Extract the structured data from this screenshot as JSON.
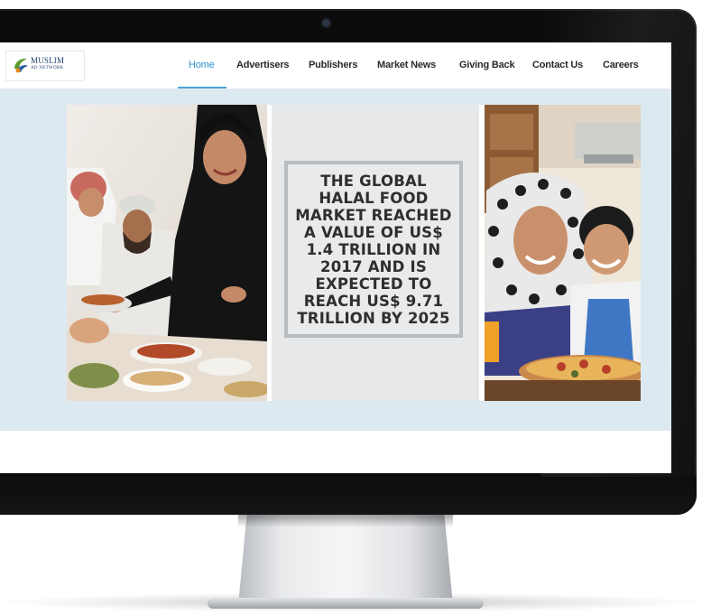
{
  "site": {
    "logo": {
      "name": "MUSLIM",
      "sub": "AD NETWORK"
    },
    "nav": {
      "items": [
        {
          "label": "Home",
          "active": true
        },
        {
          "label": "Advertisers",
          "active": false
        },
        {
          "label": "Publishers",
          "active": false
        },
        {
          "label": "Market News",
          "active": false
        },
        {
          "label": "Giving Back",
          "active": false
        },
        {
          "label": "Contact Us",
          "active": false
        },
        {
          "label": "Careers",
          "active": false
        }
      ]
    },
    "slider": {
      "headline": "THE GLOBAL HALAL FOOD MARKET REACHED A VALUE OF US$ 1.4 TRILLION IN 2017 AND IS EXPECTED TO REACH US$ 9.71 TRILLION BY 2025",
      "slide_count": 3,
      "active_slide": 2,
      "left_image": "family-dining-photo",
      "right_image": "mother-and-child-pizza-photo"
    }
  },
  "colors": {
    "accent": "#2b8fcf",
    "hero_bg": "#dde9f1",
    "bezel": "#0b0b0c"
  }
}
